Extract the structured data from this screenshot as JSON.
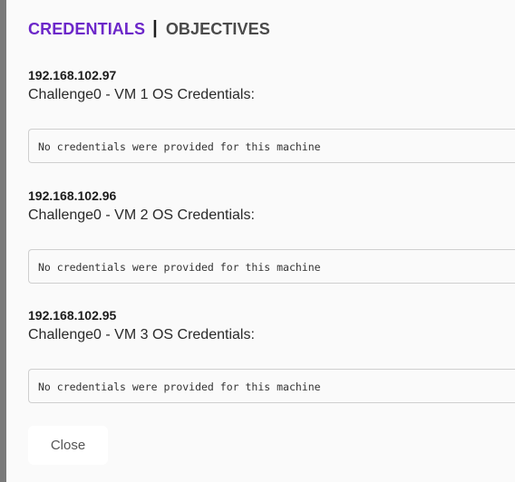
{
  "tabs": {
    "credentials": "CREDENTIALS",
    "separator": "|",
    "objectives": "OBJECTIVES"
  },
  "machines": [
    {
      "ip": "192.168.102.97",
      "label": "Challenge0 - VM 1 OS Credentials:",
      "credentials_text": "No credentials were provided for this machine"
    },
    {
      "ip": "192.168.102.96",
      "label": "Challenge0 - VM 2 OS Credentials:",
      "credentials_text": "No credentials were provided for this machine"
    },
    {
      "ip": "192.168.102.95",
      "label": "Challenge0 - VM 3 OS Credentials:",
      "credentials_text": "No credentials were provided for this machine"
    }
  ],
  "footer": {
    "close_label": "Close"
  },
  "colors": {
    "accent": "#6c27c9",
    "background": "#fafafa",
    "border": "#cfcfcf"
  }
}
